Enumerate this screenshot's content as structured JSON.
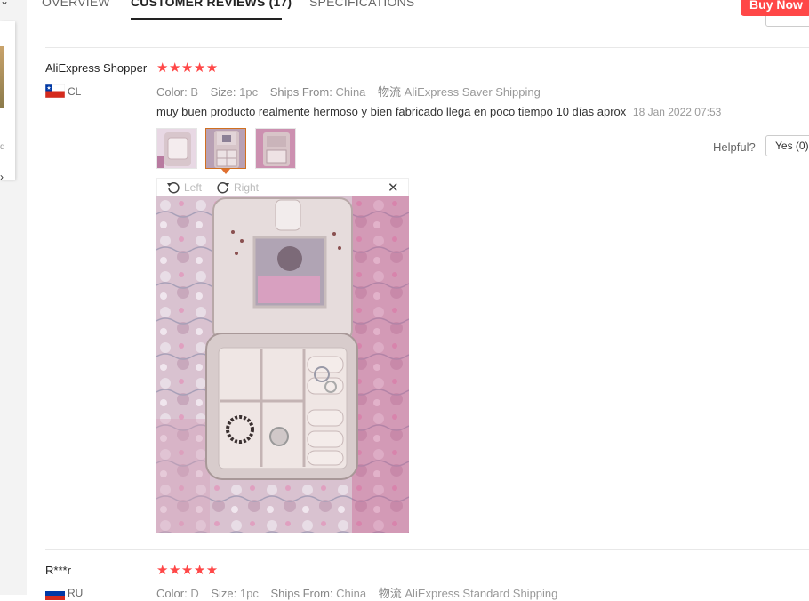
{
  "tabs": {
    "overview": "OVERVIEW",
    "reviews": "CUSTOMER REVIEWS (17)",
    "specs": "SPECIFICATIONS"
  },
  "buy_now": "Buy Now",
  "left_panel": {
    "letter": "d"
  },
  "review1": {
    "name": "AliExpress Shopper",
    "country": "CL",
    "stars": "★★★★★",
    "color_key": "Color:",
    "color_val": "B",
    "size_key": "Size:",
    "size_val": "1pc",
    "ships_key": "Ships From:",
    "ships_val": "China",
    "logistics_key": "物流",
    "logistics_val": "AliExpress Saver Shipping",
    "text": "muy buen producto realmente hermoso y bien fabricado llega en poco tiempo 10 días aprox",
    "date": "18 Jan 2022 07:53",
    "helpful": "Helpful?",
    "yes": "Yes (0)"
  },
  "viewer": {
    "left": "Left",
    "right": "Right",
    "close": "✕"
  },
  "review2": {
    "name": "R***r",
    "country": "RU",
    "stars": "★★★★★",
    "color_key": "Color:",
    "color_val": "D",
    "size_key": "Size:",
    "size_val": "1pc",
    "ships_key": "Ships From:",
    "ships_val": "China",
    "logistics_key": "物流",
    "logistics_val": "AliExpress Standard Shipping"
  },
  "colors": {
    "accent": "#ff4747",
    "active_thumb": "#d07020",
    "star": "#ff4747"
  }
}
